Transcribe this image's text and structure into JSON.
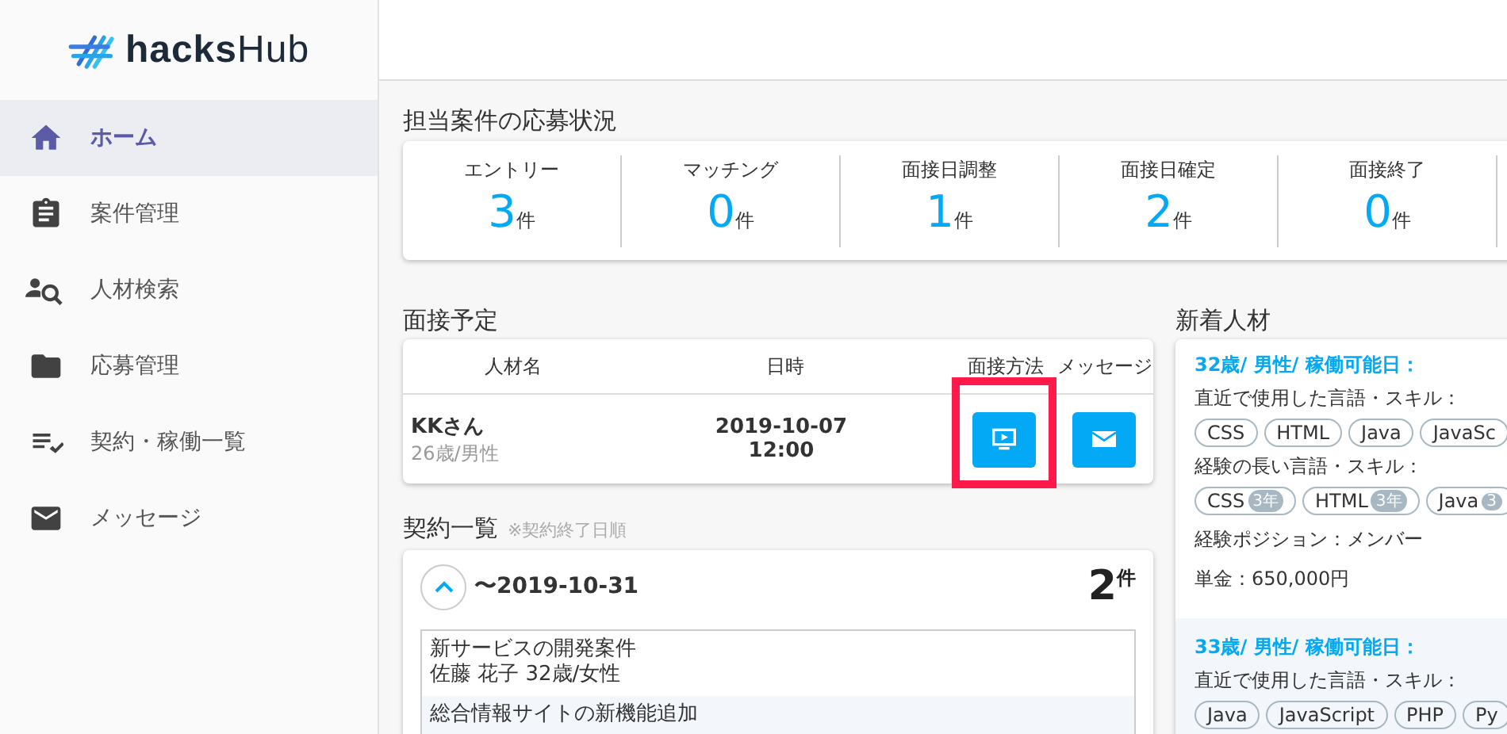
{
  "logo": {
    "bold": "hacks",
    "light": "Hub"
  },
  "sidebar": {
    "items": [
      {
        "label": "ホーム",
        "selected": true
      },
      {
        "label": "案件管理",
        "selected": false
      },
      {
        "label": "人材検索",
        "selected": false
      },
      {
        "label": "応募管理",
        "selected": false
      },
      {
        "label": "契約・稼働一覧",
        "selected": false
      },
      {
        "label": "メッセージ",
        "selected": false
      }
    ]
  },
  "applications": {
    "title": "担当案件の応募状況",
    "stats": [
      {
        "label": "エントリー",
        "count": "3",
        "unit": "件"
      },
      {
        "label": "マッチング",
        "count": "0",
        "unit": "件"
      },
      {
        "label": "面接日調整",
        "count": "1",
        "unit": "件"
      },
      {
        "label": "面接日確定",
        "count": "2",
        "unit": "件"
      },
      {
        "label": "面接終了",
        "count": "0",
        "unit": "件"
      }
    ]
  },
  "interviews": {
    "title": "面接予定",
    "columns": [
      "人材名",
      "日時",
      "面接方法",
      "メッセージ"
    ],
    "rows": [
      {
        "name": "KKさん",
        "profile": "26歳/男性",
        "date": "2019-10-07",
        "time": "12:00",
        "highlighted": true
      }
    ]
  },
  "contracts": {
    "title": "契約一覧",
    "note": "※契約終了日順",
    "groups": [
      {
        "expanded": true,
        "period": "〜2019-10-31",
        "count": "2",
        "unit": "件",
        "items": [
          {
            "title": "新サービスの開発案件",
            "person": "佐藤 花子 32歳/女性"
          },
          {
            "title": "総合情報サイトの新機能追加"
          }
        ]
      }
    ]
  },
  "new_talent": {
    "title": "新着人材",
    "cards": [
      {
        "headline": "32歳/ 男性/ 稼働可能日：",
        "recent_label": "直近で使用した言語・スキル：",
        "recent_skills": [
          "CSS",
          "HTML",
          "Java",
          "JavaSc"
        ],
        "long_label": "経験の長い言語・スキル：",
        "long_skills": [
          {
            "name": "CSS",
            "years": "3年"
          },
          {
            "name": "HTML",
            "years": "3年"
          },
          {
            "name": "Java",
            "years": "3"
          }
        ],
        "position": "経験ポジション：メンバー",
        "rate": "単金：650,000円"
      },
      {
        "headline": "33歳/ 男性/ 稼働可能日：",
        "recent_label": "直近で使用した言語・スキル：",
        "recent_skills": [
          "Java",
          "JavaScript",
          "PHP",
          "Py"
        ]
      }
    ]
  }
}
